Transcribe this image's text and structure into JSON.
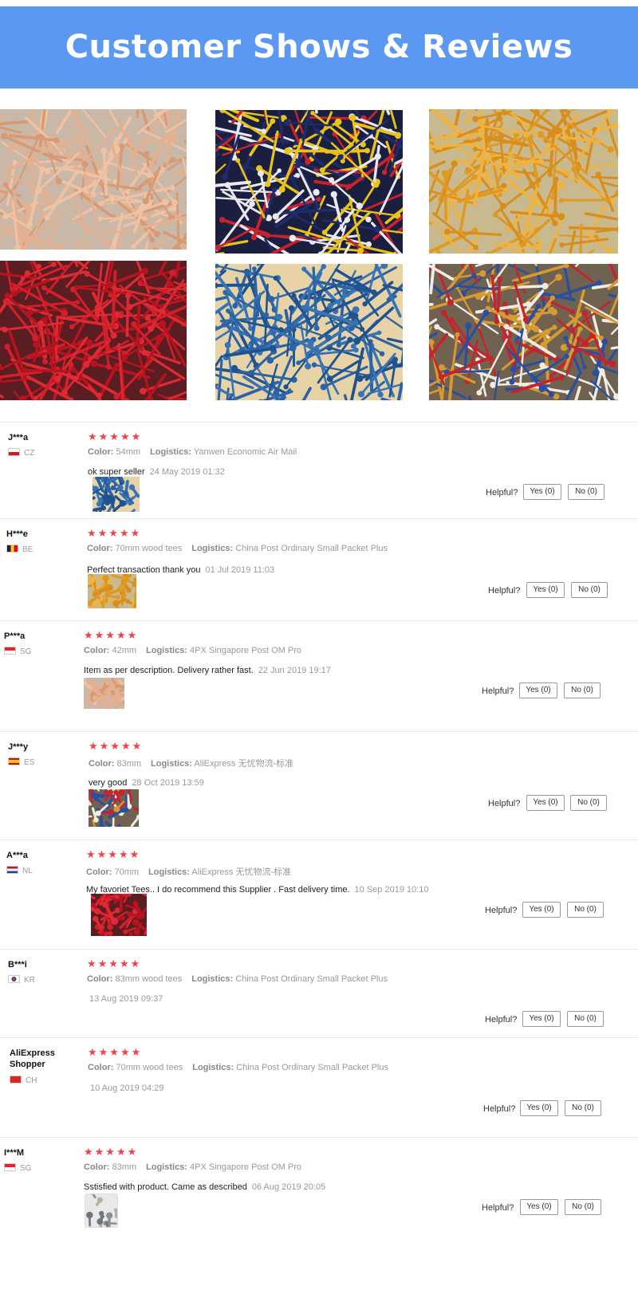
{
  "banner": {
    "title": "Customer Shows & Reviews",
    "color": "#5b98f2"
  },
  "gallery": [
    {
      "name": "peach-tees-photo",
      "color": "#e3ad8a",
      "colors": [
        "#d79a74",
        "#efc2a4",
        "#e6b08e"
      ],
      "bg": "#c9b8a8"
    },
    {
      "name": "multicolor-tees-photo",
      "color": "#1f2b6b",
      "colors": [
        "#1f2b6b",
        "#e8c31a",
        "#c8232c",
        "#e9e9ef"
      ],
      "bg": "#1a1f40"
    },
    {
      "name": "orange-tees-photo",
      "color": "#e9a32b",
      "colors": [
        "#e09a22",
        "#f0b33d",
        "#d98d1a"
      ],
      "bg": "#c9b98f"
    },
    {
      "name": "red-tees-photo",
      "color": "#d41e2a",
      "colors": [
        "#d41e2a",
        "#e02a33",
        "#b8141f"
      ],
      "bg": "#5a1d22"
    },
    {
      "name": "blue-tees-photo",
      "color": "#2a63a6",
      "colors": [
        "#2a63a6",
        "#1e5390",
        "#3874b5"
      ],
      "bg": "#e8d3a6"
    },
    {
      "name": "mixed-tees-photo",
      "color": "#d8a044",
      "colors": [
        "#d89a2e",
        "#2a4fa0",
        "#f1ece2",
        "#c8232c"
      ],
      "bg": "#6f6250"
    }
  ],
  "helpful_label": "Helpful?",
  "star_glyphs": "★★★★★",
  "reviews": [
    {
      "name": "J***a",
      "country": "CZ",
      "flag": "cz",
      "color_label": "Color:",
      "color": "54mm",
      "logistics_label": "Logistics:",
      "logistics": "Yanwen Economic Air Mail",
      "text": "ok super seller",
      "date": "24 May 2019 01:32",
      "yes": "Yes (0)",
      "no": "No (0)",
      "thumb": "blue"
    },
    {
      "name": "H***e",
      "country": "BE",
      "flag": "be",
      "color_label": "Color:",
      "color": "70mm wood tees",
      "logistics_label": "Logistics:",
      "logistics": "China Post Ordinary Small Packet Plus",
      "text": "Perfect transaction thank you",
      "date": "01 Jul 2019 11:03",
      "yes": "Yes (0)",
      "no": "No (0)",
      "thumb": "orange"
    },
    {
      "name": "P***a",
      "country": "SG",
      "flag": "sg",
      "color_label": "Color:",
      "color": "42mm",
      "logistics_label": "Logistics:",
      "logistics": "4PX Singapore Post OM Pro",
      "text": "Item as per description. Delivery rather fast.",
      "date": "22 Jun 2019 19:17",
      "yes": "Yes (0)",
      "no": "No (0)",
      "thumb": "peach"
    },
    {
      "name": "J***y",
      "country": "ES",
      "flag": "es",
      "color_label": "Color:",
      "color": "83mm",
      "logistics_label": "Logistics:",
      "logistics": "AliExpress 无忧物流-标准",
      "text": "very good",
      "date": "28 Oct 2019 13:59",
      "yes": "Yes (0)",
      "no": "No (0)",
      "thumb": "mixed"
    },
    {
      "name": "A***a",
      "country": "NL",
      "flag": "nl",
      "color_label": "Color:",
      "color": "70mm",
      "logistics_label": "Logistics:",
      "logistics": "AliExpress 无忧物流-标准",
      "text": "My favoriet Tees.. I do recommend this Supplier . Fast delivery time.",
      "date": "10 Sep 2019 10:10",
      "yes": "Yes (0)",
      "no": "No (0)",
      "thumb": "red"
    },
    {
      "name": "B***i",
      "country": "KR",
      "flag": "kr",
      "color_label": "Color:",
      "color": "83mm wood tees",
      "logistics_label": "Logistics:",
      "logistics": "China Post Ordinary Small Packet Plus",
      "text": "",
      "date": "13 Aug 2019 09:37",
      "yes": "Yes (0)",
      "no": "No (0)",
      "thumb": ""
    },
    {
      "name": "AliExpress Shopper",
      "country": "CH",
      "flag": "ch",
      "color_label": "Color:",
      "color": "70mm wood tees",
      "logistics_label": "Logistics:",
      "logistics": "China Post Ordinary Small Packet Plus",
      "text": "",
      "date": "10 Aug 2019 04:29",
      "yes": "Yes (0)",
      "no": "No (0)",
      "thumb": ""
    },
    {
      "name": "I***M",
      "country": "SG",
      "flag": "sg",
      "color_label": "Color:",
      "color": "83mm",
      "logistics_label": "Logistics:",
      "logistics": "4PX Singapore Post OM Pro",
      "text": "Sstisfied with product. Came as described",
      "date": "06 Aug 2019 20:05",
      "yes": "Yes (0)",
      "no": "No (0)",
      "thumb": "phone"
    }
  ],
  "star_color": "#f0424a"
}
